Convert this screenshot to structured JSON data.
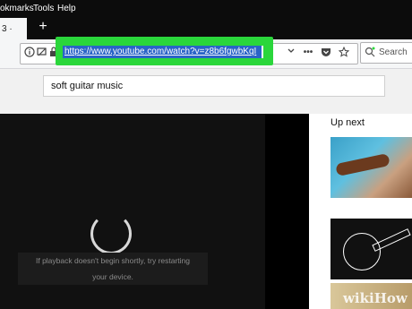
{
  "menu": {
    "items": [
      "okmarks",
      "Tools",
      "Help"
    ]
  },
  "tabs": {
    "active_tab_fragment": "3 ·",
    "new_tab": "+"
  },
  "toolbar": {
    "url": "https://www.youtube.com/watch?v=z8b6fgwbKqI",
    "info_icon": "info-icon",
    "permissions_icon": "permissions-icon",
    "lock_icon": "lock-icon",
    "dropdown_icon": "chevron-down-icon",
    "more_icon": "•••",
    "pocket_icon": "pocket-icon",
    "bookmark_icon": "star-icon",
    "search_placeholder": "Search"
  },
  "youtube": {
    "search_query": "soft guitar music",
    "player_message_line1": "If playback doesn't begin shortly, try restarting",
    "player_message_line2": "your device.",
    "up_next": "Up next"
  },
  "watermark": "wikiHow",
  "colors": {
    "highlight": "#2ad63b",
    "selection": "#2a64c7"
  }
}
